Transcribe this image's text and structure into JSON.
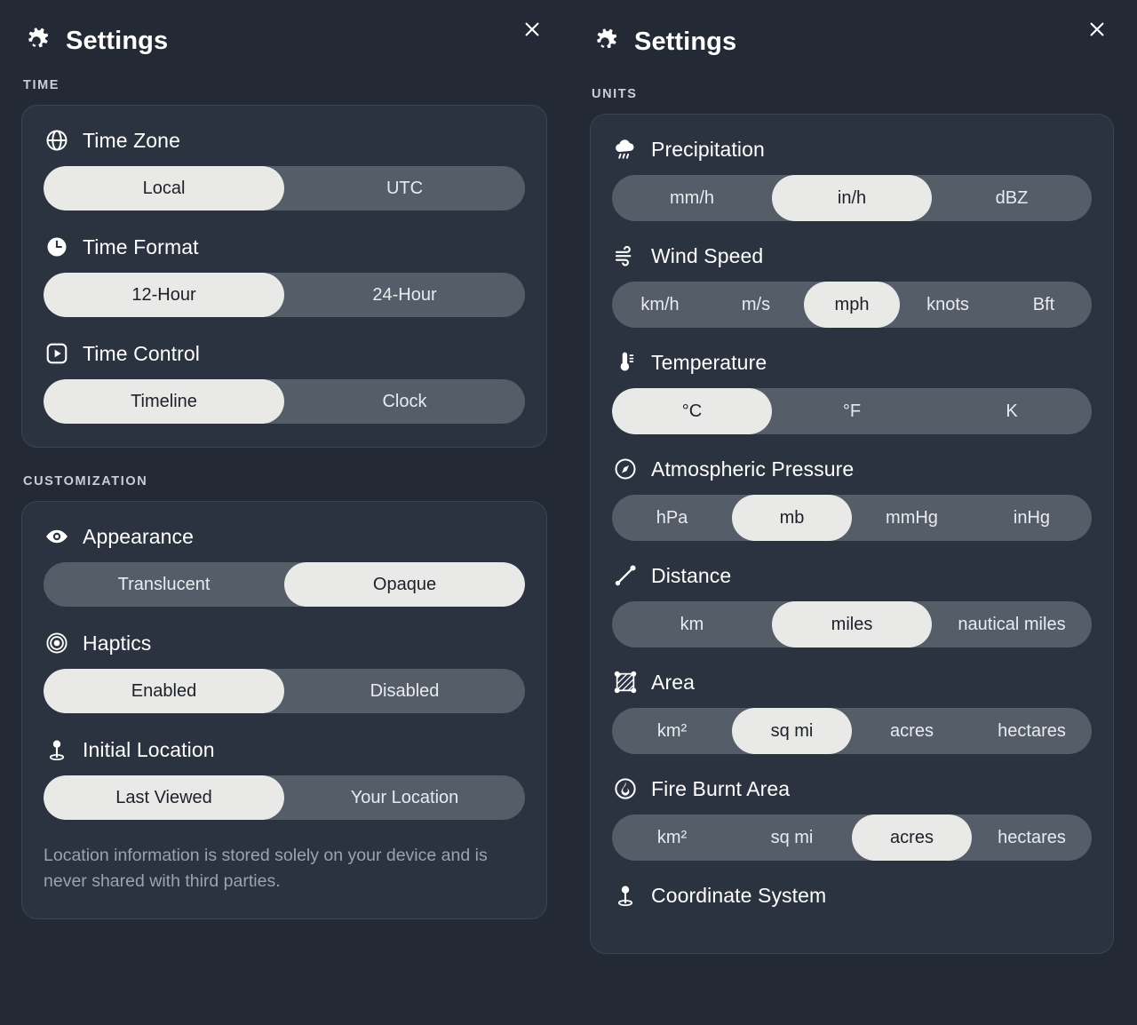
{
  "theme": {
    "background": "#232a36",
    "card_background": "#2b3240",
    "card_border": "#3c4452",
    "track": "#555d69",
    "selected_pill": "#e9e9e7",
    "selected_text": "#1c2028",
    "text": "#ffffff",
    "muted_text": "#9aa3b0",
    "section_label": "#c9ced8"
  },
  "left_panel": {
    "title": "Settings",
    "gear_icon": "gear-icon",
    "close_icon": "close-icon",
    "sections": [
      {
        "label": "TIME",
        "settings": [
          {
            "name": "Time Zone",
            "icon": "globe-icon",
            "options": [
              "Local",
              "UTC"
            ],
            "selected": 0
          },
          {
            "name": "Time Format",
            "icon": "clock-icon",
            "options": [
              "12-Hour",
              "24-Hour"
            ],
            "selected": 0
          },
          {
            "name": "Time Control",
            "icon": "play-square-icon",
            "options": [
              "Timeline",
              "Clock"
            ],
            "selected": 0
          }
        ]
      },
      {
        "label": "CUSTOMIZATION",
        "settings": [
          {
            "name": "Appearance",
            "icon": "eye-icon",
            "options": [
              "Translucent",
              "Opaque"
            ],
            "selected": 1
          },
          {
            "name": "Haptics",
            "icon": "haptics-rings-icon",
            "options": [
              "Enabled",
              "Disabled"
            ],
            "selected": 0
          },
          {
            "name": "Initial Location",
            "icon": "location-pin-icon",
            "options": [
              "Last Viewed",
              "Your Location"
            ],
            "selected": 0
          }
        ],
        "note": "Location information is stored solely on your device and is never shared with third parties."
      }
    ]
  },
  "right_panel": {
    "title": "Settings",
    "gear_icon": "gear-icon",
    "close_icon": "close-icon",
    "sections": [
      {
        "label": "UNITS",
        "settings": [
          {
            "name": "Precipitation",
            "icon": "rain-cloud-icon",
            "options": [
              "mm/h",
              "in/h",
              "dBZ"
            ],
            "selected": 1
          },
          {
            "name": "Wind Speed",
            "icon": "wind-icon",
            "options": [
              "km/h",
              "m/s",
              "mph",
              "knots",
              "Bft"
            ],
            "selected": 2
          },
          {
            "name": "Temperature",
            "icon": "thermometer-icon",
            "options": [
              "°C",
              "°F",
              "K"
            ],
            "selected": 0
          },
          {
            "name": "Atmospheric Pressure",
            "icon": "compass-icon",
            "options": [
              "hPa",
              "mb",
              "mmHg",
              "inHg"
            ],
            "selected": 1
          },
          {
            "name": "Distance",
            "icon": "distance-line-icon",
            "options": [
              "km",
              "miles",
              "nautical miles"
            ],
            "selected": 1
          },
          {
            "name": "Area",
            "icon": "area-hatched-square-icon",
            "options": [
              "km²",
              "sq mi",
              "acres",
              "hectares"
            ],
            "selected": 1
          },
          {
            "name": "Fire Burnt Area",
            "icon": "flame-circle-icon",
            "options": [
              "km²",
              "sq mi",
              "acres",
              "hectares"
            ],
            "selected": 2
          },
          {
            "name": "Coordinate System",
            "icon": "location-pin-icon",
            "options": [],
            "selected": -1
          }
        ]
      }
    ]
  }
}
